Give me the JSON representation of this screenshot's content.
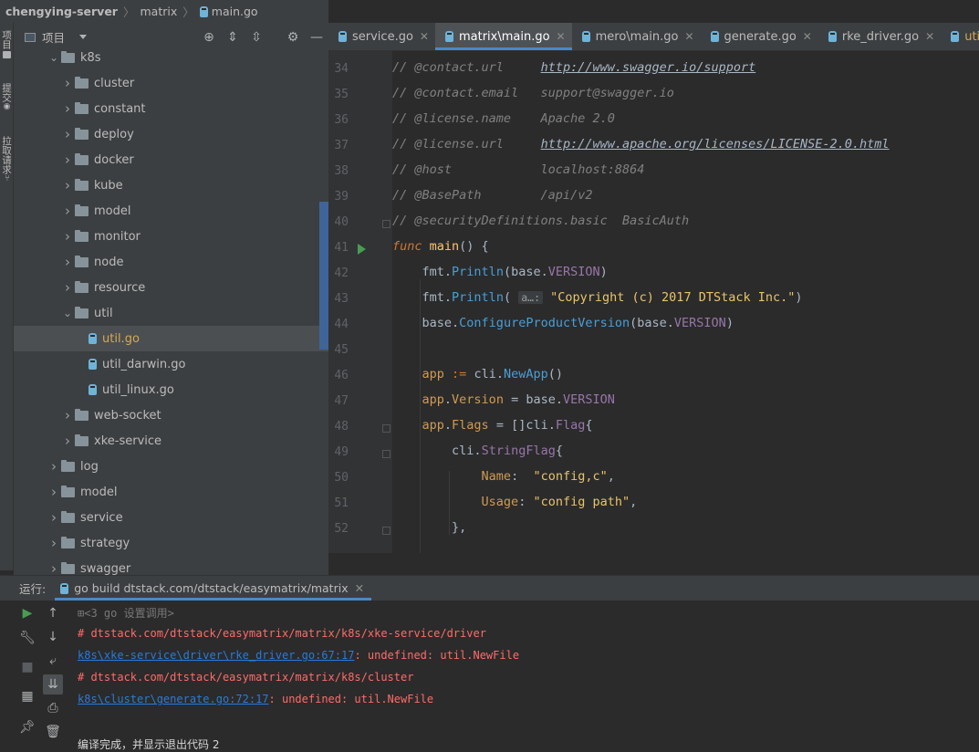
{
  "breadcrumb": {
    "project": "chengying-server",
    "folder": "matrix",
    "file": "main.go"
  },
  "left_strip": {
    "project_label": "项目",
    "commit_label": "提交",
    "pull_label": "拉取请求"
  },
  "project_panel": {
    "title": "项目",
    "tree": [
      {
        "label": "k8s",
        "type": "folder",
        "depth": 2,
        "expanded": true
      },
      {
        "label": "cluster",
        "type": "folder",
        "depth": 3,
        "expanded": false
      },
      {
        "label": "constant",
        "type": "folder",
        "depth": 3,
        "expanded": false
      },
      {
        "label": "deploy",
        "type": "folder",
        "depth": 3,
        "expanded": false
      },
      {
        "label": "docker",
        "type": "folder",
        "depth": 3,
        "expanded": false
      },
      {
        "label": "kube",
        "type": "folder",
        "depth": 3,
        "expanded": false
      },
      {
        "label": "model",
        "type": "folder",
        "depth": 3,
        "expanded": false
      },
      {
        "label": "monitor",
        "type": "folder",
        "depth": 3,
        "expanded": false
      },
      {
        "label": "node",
        "type": "folder",
        "depth": 3,
        "expanded": false
      },
      {
        "label": "resource",
        "type": "folder",
        "depth": 3,
        "expanded": false
      },
      {
        "label": "util",
        "type": "folder",
        "depth": 3,
        "expanded": true
      },
      {
        "label": "util.go",
        "type": "file",
        "depth": 4,
        "selected": true
      },
      {
        "label": "util_darwin.go",
        "type": "file",
        "depth": 4
      },
      {
        "label": "util_linux.go",
        "type": "file",
        "depth": 4
      },
      {
        "label": "web-socket",
        "type": "folder",
        "depth": 3,
        "expanded": false
      },
      {
        "label": "xke-service",
        "type": "folder",
        "depth": 3,
        "expanded": false
      },
      {
        "label": "log",
        "type": "folder",
        "depth": 2,
        "expanded": false
      },
      {
        "label": "model",
        "type": "folder",
        "depth": 2,
        "expanded": false
      },
      {
        "label": "service",
        "type": "folder",
        "depth": 2,
        "expanded": false
      },
      {
        "label": "strategy",
        "type": "folder",
        "depth": 2,
        "expanded": false
      },
      {
        "label": "swagger",
        "type": "folder",
        "depth": 2,
        "expanded": false
      }
    ]
  },
  "editor_tabs": [
    {
      "label": "service.go",
      "active": false
    },
    {
      "label": "matrix\\main.go",
      "active": true
    },
    {
      "label": "mero\\main.go",
      "active": false
    },
    {
      "label": "generate.go",
      "active": false
    },
    {
      "label": "rke_driver.go",
      "active": false
    },
    {
      "label": "util.go",
      "active": false,
      "modified": true
    }
  ],
  "code": {
    "line_numbers": [
      "34",
      "35",
      "36",
      "37",
      "38",
      "39",
      "40",
      "41",
      "42",
      "43",
      "44",
      "45",
      "46",
      "47",
      "48",
      "49",
      "50",
      "51",
      "52"
    ],
    "l34": {
      "a": "// @contact.url     ",
      "b": "http://www.swagger.io/support"
    },
    "l35": "// @contact.email   support@swagger.io",
    "l36": "// @license.name    Apache 2.0",
    "l37": {
      "a": "// @license.url     ",
      "b": "http://www.apache.org/licenses/LICENSE-2.0.html"
    },
    "l38": "// @host            localhost:8864",
    "l39": "// @BasePath        /api/v2",
    "l40": "// @securityDefinitions.basic  BasicAuth",
    "l41": {
      "kw": "func",
      "fn": "main",
      "rest": "() {"
    },
    "l42": {
      "pk": "fmt",
      "m": "Println",
      "a": "base",
      "c": "VERSION"
    },
    "l43": {
      "pk": "fmt",
      "m": "Println",
      "hint": "a…:",
      "s": "\"Copyright (c) 2017 DTStack Inc.\""
    },
    "l44": {
      "pk": "base",
      "m": "ConfigureProductVersion",
      "a": "base",
      "c": "VERSION"
    },
    "l46": {
      "v": "app",
      "op": ":=",
      "pk": "cli",
      "m": "NewApp"
    },
    "l47": {
      "v": "app",
      "f": "Version",
      "pk": "base",
      "c": "VERSION"
    },
    "l48": {
      "v": "app",
      "f": "Flags",
      "pk": "cli",
      "t": "Flag"
    },
    "l49": {
      "pk": "cli",
      "t": "StringFlag"
    },
    "l50": {
      "f": "Name",
      "s": "\"config,c\""
    },
    "l51": {
      "f": "Usage",
      "s": "\"config path\""
    },
    "l52": "},"
  },
  "run_panel": {
    "label": "运行:",
    "tab": "go build dtstack.com/dtstack/easymatrix/matrix",
    "lines": [
      {
        "text": "<3 go 设置调用>",
        "kind": "gray"
      },
      {
        "text": "# dtstack.com/dtstack/easymatrix/matrix/k8s/xke-service/driver",
        "kind": "red"
      },
      {
        "link": "k8s\\xke-service\\driver\\rke_driver.go:67:17",
        "text": ": undefined: util.NewFile",
        "kind": "error"
      },
      {
        "text": "# dtstack.com/dtstack/easymatrix/matrix/k8s/cluster",
        "kind": "red"
      },
      {
        "link": "k8s\\cluster\\generate.go:72:17",
        "text": ": undefined: util.NewFile",
        "kind": "error"
      },
      {
        "text": "编译完成，并显示退出代码 2",
        "kind": "plain"
      }
    ]
  }
}
